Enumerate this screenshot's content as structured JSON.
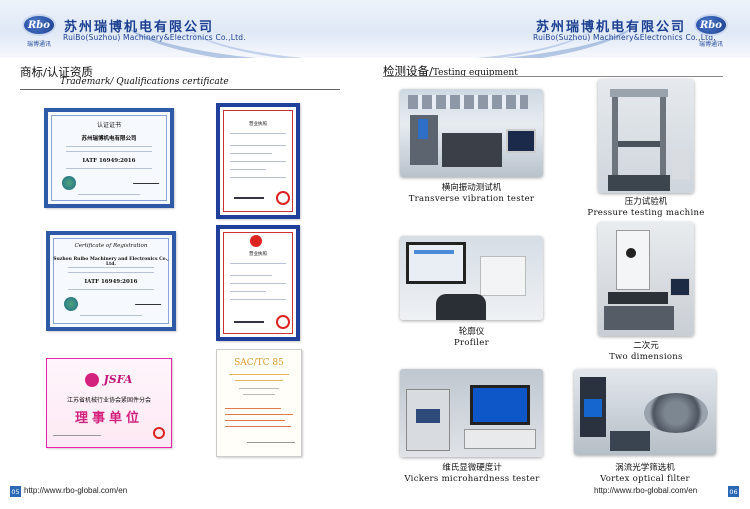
{
  "header": {
    "left": {
      "logo_text": "Rbo",
      "logo_sub": "瑞博通讯",
      "company_cn": "苏州瑞博机电有限公司",
      "company_en": "RuiBo(Suzhou) Machinery&Electronics Co.,Ltd."
    },
    "right": {
      "logo_text": "Rbo",
      "logo_sub": "瑞博通讯",
      "company_cn": "苏州瑞博机电有限公司",
      "company_en": "RuiBo(Suzhou) Machinery&Electronics Co.,Ltd."
    }
  },
  "left_section": {
    "title_cn": "商标/认证资质",
    "title_en": "Trademark/ Qualifications certificate",
    "certificates": [
      {
        "name": "IATF 16949 certificate (Chinese)",
        "heading": "认证证书",
        "company": "苏州瑞博机电有限公司",
        "standard": "IATF 16949:2016"
      },
      {
        "name": "business license 1",
        "heading": "营业执照"
      },
      {
        "name": "Certificate of Registration",
        "heading": "Certificate of Registration",
        "company": "Suzhou Ruibo Machinery and Electronics Co., Ltd.",
        "standard": "IATF 16949:2016"
      },
      {
        "name": "business license 2",
        "heading": "营业执照"
      },
      {
        "name": "JSFA",
        "logo": "JSFA",
        "org": "江苏省机械行业协会紧固件分会",
        "title": "理事单位"
      },
      {
        "name": "SAC/TC 85",
        "heading": "SAC/TC 85"
      }
    ]
  },
  "right_section": {
    "title_cn": "检测设备/",
    "title_en": "Testing equipment",
    "equipment": [
      {
        "label_cn": "横向振动测试机",
        "label_en": "Transverse vibration tester"
      },
      {
        "label_cn": "压力试验机",
        "label_en": "Pressure testing machine"
      },
      {
        "label_cn": "轮廓仪",
        "label_en": "Profiler"
      },
      {
        "label_cn": "二次元",
        "label_en": "Two dimensions"
      },
      {
        "label_cn": "维氏显微硬度计",
        "label_en": "Vickers microhardness tester"
      },
      {
        "label_cn": "涡流光学筛选机",
        "label_en": "Vortex optical filter"
      }
    ]
  },
  "footer": {
    "left_page": "05",
    "left_url": "http://www.rbo-global.com/en",
    "right_page": "06",
    "right_url": "http://www.rbo-global.com/en"
  },
  "colors": {
    "brand_blue": "#1b3f91",
    "accent": "#2a67b5"
  }
}
